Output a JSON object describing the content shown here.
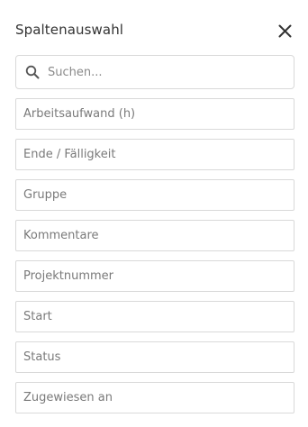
{
  "panel": {
    "title": "Spaltenauswahl",
    "close_icon": "close-icon"
  },
  "search": {
    "placeholder": "Suchen...",
    "value": "",
    "icon": "search-icon"
  },
  "columns": [
    {
      "label": "Arbeitsaufwand (h)"
    },
    {
      "label": "Ende / Fälligkeit"
    },
    {
      "label": "Gruppe"
    },
    {
      "label": "Kommentare"
    },
    {
      "label": "Projektnummer"
    },
    {
      "label": "Start"
    },
    {
      "label": "Status"
    },
    {
      "label": "Zugewiesen an"
    }
  ],
  "colors": {
    "border": "#d9d9d9",
    "text": "#333333",
    "muted_text": "#7a7a7a",
    "background": "#ffffff"
  }
}
